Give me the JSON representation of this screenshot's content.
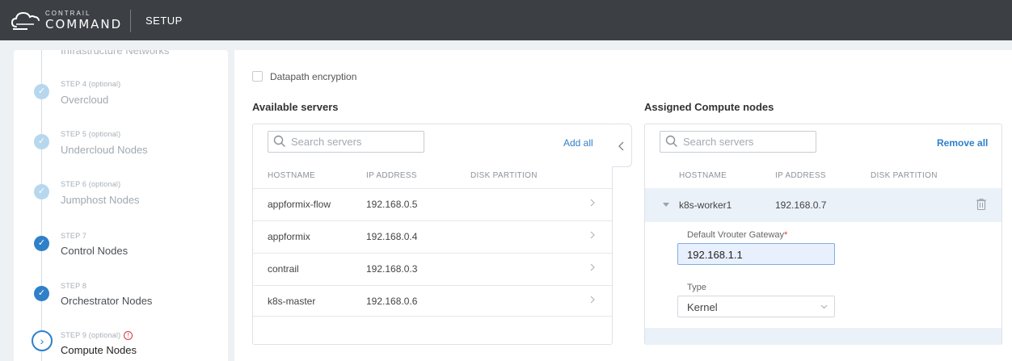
{
  "header": {
    "brand_top": "CONTRAIL",
    "brand_main": "COMMAND",
    "section": "SETUP",
    "colors": {
      "bar": "#3c3f44",
      "accent": "#2f80c9"
    }
  },
  "steps": {
    "cut_off_title": "Infrastructure Networks",
    "items": [
      {
        "kicker": "STEP 4 (optional)",
        "title": "Overcloud",
        "state": "done-skipped",
        "icon": "check-icon"
      },
      {
        "kicker": "STEP 5 (optional)",
        "title": "Undercloud Nodes",
        "state": "done-skipped",
        "icon": "check-icon"
      },
      {
        "kicker": "STEP 6 (optional)",
        "title": "Jumphost Nodes",
        "state": "done-skipped",
        "icon": "check-icon"
      },
      {
        "kicker": "STEP 7",
        "title": "Control Nodes",
        "state": "done",
        "icon": "check-icon"
      },
      {
        "kicker": "STEP 8",
        "title": "Orchestrator Nodes",
        "state": "done",
        "icon": "check-icon"
      },
      {
        "kicker": "STEP 9 (optional)",
        "title": "Compute Nodes",
        "state": "current",
        "icon": "chevron-right-icon",
        "warning": "!"
      }
    ]
  },
  "options": {
    "datapath_encryption_label": "Datapath encryption",
    "datapath_encryption_checked": false
  },
  "available": {
    "title": "Available servers",
    "search_placeholder": "Search servers",
    "action": "Add all",
    "columns": [
      "HOSTNAME",
      "IP ADDRESS",
      "DISK PARTITION"
    ],
    "rows": [
      {
        "hostname": "appformix-flow",
        "ip": "192.168.0.5",
        "disk": ""
      },
      {
        "hostname": "appformix",
        "ip": "192.168.0.4",
        "disk": ""
      },
      {
        "hostname": "contrail",
        "ip": "192.168.0.3",
        "disk": ""
      },
      {
        "hostname": "k8s-master",
        "ip": "192.168.0.6",
        "disk": ""
      }
    ]
  },
  "assigned": {
    "title": "Assigned Compute nodes",
    "search_placeholder": "Search servers",
    "action": "Remove all",
    "columns": [
      "HOSTNAME",
      "IP ADDRESS",
      "DISK PARTITION"
    ],
    "rows": [
      {
        "hostname": "k8s-worker1",
        "ip": "192.168.0.7",
        "disk": "",
        "expanded": true
      }
    ],
    "detail": {
      "gateway_label": "Default Vrouter Gateway",
      "gateway_required": "*",
      "gateway_value": "192.168.1.1",
      "type_label": "Type",
      "type_value": "Kernel"
    }
  }
}
